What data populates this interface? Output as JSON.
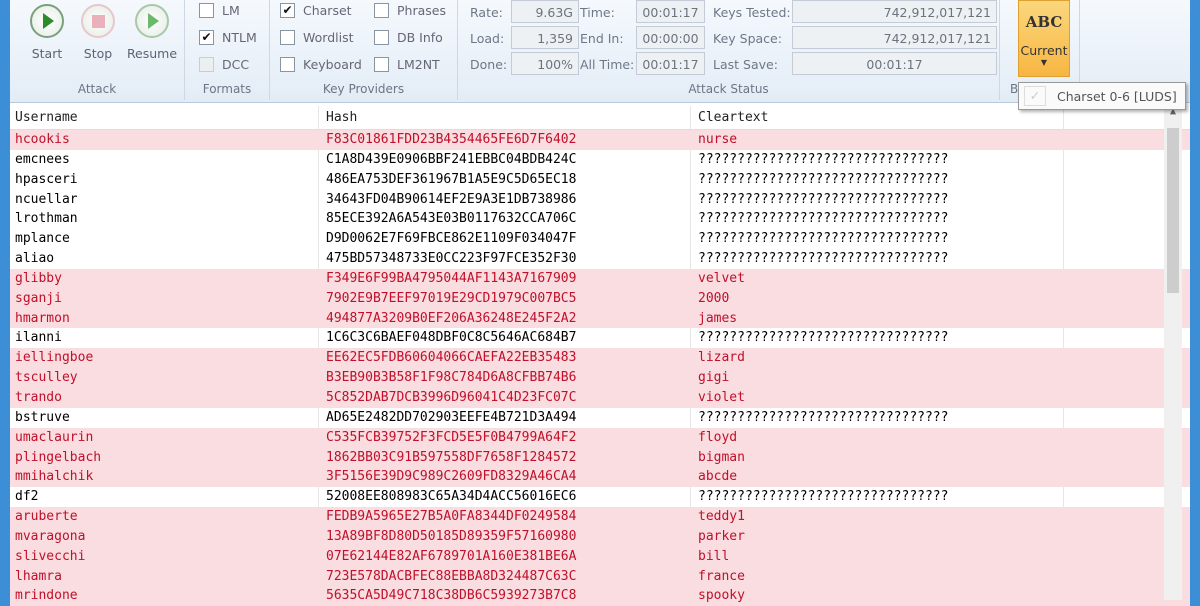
{
  "ribbon": {
    "attack": {
      "label": "Attack",
      "start": "Start",
      "stop": "Stop",
      "resume": "Resume"
    },
    "formats": {
      "label": "Formats",
      "items": [
        {
          "label": "LM",
          "checked": false
        },
        {
          "label": "NTLM",
          "checked": true
        },
        {
          "label": "DCC",
          "checked": false,
          "disabled": true
        }
      ]
    },
    "key_providers": {
      "label": "Key Providers",
      "items": [
        {
          "label": "Charset",
          "checked": true
        },
        {
          "label": "Wordlist",
          "checked": false
        },
        {
          "label": "Keyboard",
          "checked": false
        },
        {
          "label": "Phrases",
          "checked": false
        },
        {
          "label": "DB Info",
          "checked": false
        },
        {
          "label": "LM2NT",
          "checked": false
        }
      ]
    },
    "status": {
      "label": "Attack Status",
      "rate_label": "Rate:",
      "rate": "9.63G",
      "load_label": "Load:",
      "load": "1,359",
      "done_label": "Done:",
      "done": "100%",
      "time_label": "Time:",
      "time": "00:01:17",
      "endin_label": "End In:",
      "endin": "00:00:00",
      "alltime_label": "All Time:",
      "alltime": "00:01:17",
      "keys_tested_label": "Keys Tested:",
      "keys_tested": "742,912,017,121",
      "key_space_label": "Key Space:",
      "key_space": "742,912,017,121",
      "last_save_label": "Last Save:",
      "last_save": "00:01:17"
    },
    "batch": {
      "label": "Ba",
      "icon_text": "ABC",
      "current": "Current"
    },
    "popup": {
      "item": "Charset 0-6 [LUDS]"
    }
  },
  "colors": {
    "cracked_bg": "#f9dde0",
    "cracked_text": "#c0102a",
    "orange": "#f7b643"
  },
  "table": {
    "headers": [
      "Username",
      "Hash",
      "Cleartext"
    ],
    "rows": [
      {
        "u": "hcookis",
        "h": "F83C01861FDD23B4354465FE6D7F6402",
        "c": "nurse",
        "cracked": true
      },
      {
        "u": "emcnees",
        "h": "C1A8D439E0906BBF241EBBC04BDB424C",
        "c": "????????????????????????????????",
        "cracked": false
      },
      {
        "u": "hpasceri",
        "h": "486EA753DEF361967B1A5E9C5D65EC18",
        "c": "????????????????????????????????",
        "cracked": false
      },
      {
        "u": "ncuellar",
        "h": "34643FD04B90614EF2E9A3E1DB738986",
        "c": "????????????????????????????????",
        "cracked": false
      },
      {
        "u": "lrothman",
        "h": "85ECE392A6A543E03B0117632CCA706C",
        "c": "????????????????????????????????",
        "cracked": false
      },
      {
        "u": "mplance",
        "h": "D9D0062E7F69FBCE862E1109F034047F",
        "c": "????????????????????????????????",
        "cracked": false
      },
      {
        "u": "aliao",
        "h": "475BD57348733E0CC223F97FCE352F30",
        "c": "????????????????????????????????",
        "cracked": false
      },
      {
        "u": "glibby",
        "h": "F349E6F99BA4795044AF1143A7167909",
        "c": "velvet",
        "cracked": true
      },
      {
        "u": "sganji",
        "h": "7902E9B7EEF97019E29CD1979C007BC5",
        "c": "2000",
        "cracked": true
      },
      {
        "u": "hmarmon",
        "h": "494877A3209B0EF206A36248E245F2A2",
        "c": "james",
        "cracked": true
      },
      {
        "u": "ilanni",
        "h": "1C6C3C6BAEF048DBF0C8C5646AC684B7",
        "c": "????????????????????????????????",
        "cracked": false
      },
      {
        "u": "iellingboe",
        "h": "EE62EC5FDB60604066CAEFA22EB35483",
        "c": "lizard",
        "cracked": true
      },
      {
        "u": "tsculley",
        "h": "B3EB90B3B58F1F98C784D6A8CFBB74B6",
        "c": "gigi",
        "cracked": true
      },
      {
        "u": "trando",
        "h": "5C852DAB7DCB3996D96041C4D23FC07C",
        "c": "violet",
        "cracked": true
      },
      {
        "u": "bstruve",
        "h": "AD65E2482DD702903EEFE4B721D3A494",
        "c": "????????????????????????????????",
        "cracked": false
      },
      {
        "u": "umaclaurin",
        "h": "C535FCB39752F3FCD5E5F0B4799A64F2",
        "c": "floyd",
        "cracked": true
      },
      {
        "u": "plingelbach",
        "h": "1862BB03C91B597558DF7658F1284572",
        "c": "bigman",
        "cracked": true
      },
      {
        "u": "mmihalchik",
        "h": "3F5156E39D9C989C2609FD8329A46CA4",
        "c": "abcde",
        "cracked": true
      },
      {
        "u": "df2",
        "h": "52008EE808983C65A34D4ACC56016EC6",
        "c": "????????????????????????????????",
        "cracked": false
      },
      {
        "u": "aruberte",
        "h": "FEDB9A5965E27B5A0FA8344DF0249584",
        "c": "teddy1",
        "cracked": true
      },
      {
        "u": "mvaragona",
        "h": "13A89BF8D80D50185D89359F57160980",
        "c": "parker",
        "cracked": true
      },
      {
        "u": "slivecchi",
        "h": "07E62144E82AF6789701A160E381BE6A",
        "c": "bill",
        "cracked": true
      },
      {
        "u": "lhamra",
        "h": "723E578DACBFEC88EBBA8D324487C63C",
        "c": "france",
        "cracked": true
      },
      {
        "u": "mrindone",
        "h": "5635CA5D49C718C38DB6C5939273B7C8",
        "c": "spooky",
        "cracked": true
      }
    ]
  }
}
